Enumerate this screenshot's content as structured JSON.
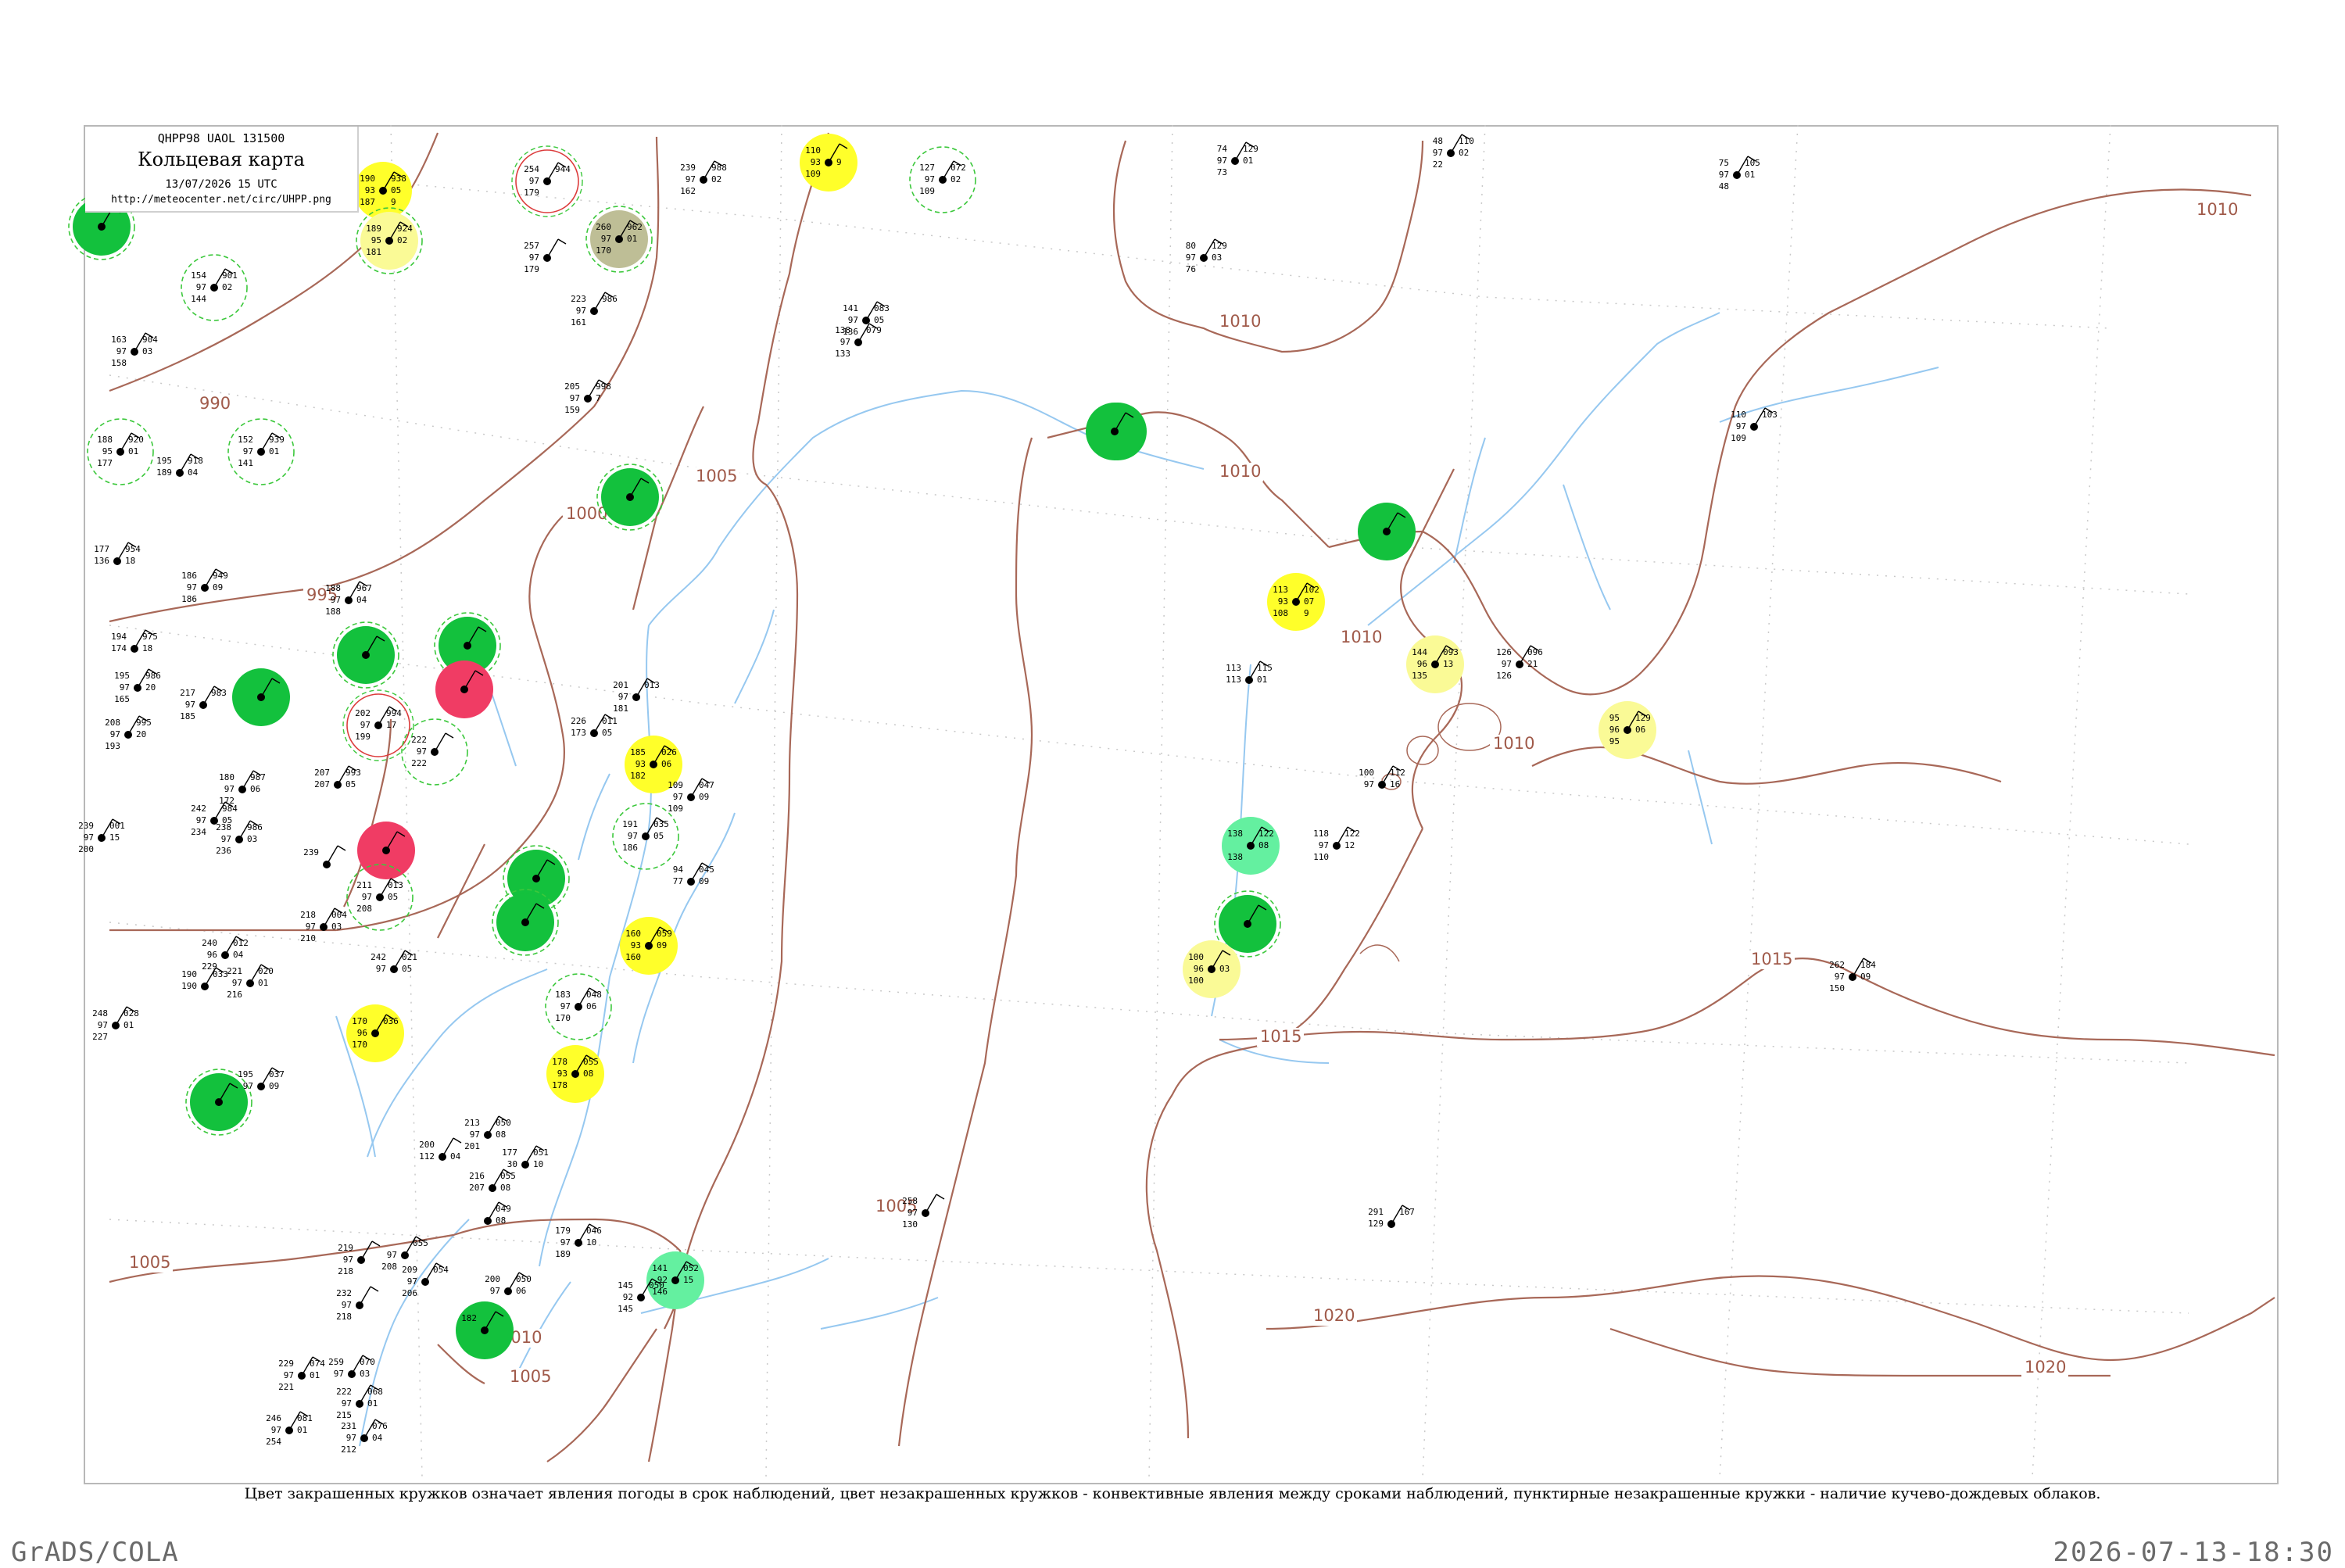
{
  "header": {
    "code_line": "QHPP98  UAOL  131500",
    "title": "Кольцевая карта",
    "date_line": "13/07/2026 15 UTC",
    "url": "http://meteocenter.net/circ/UHPP.png"
  },
  "caption": "Цвет закрашенных кружков означает явления погоды в срок наблюдений, цвет незакрашенных кружков - конвективные явления между сроками наблюдений, пунктирные незакрашенные кружки - наличие кучево-дождевых облаков.",
  "footer": {
    "left": "GrADS/COLA",
    "right": "2026-07-13-18:30"
  },
  "colors": {
    "frame": "#b8b8b8",
    "isobar": "#a86858",
    "coast": "#96c8f0",
    "circle_green": "#13c13d",
    "circle_yellow": "#ffff2a",
    "circle_lightyellow": "#fafa96",
    "circle_red": "#f03c64",
    "circle_mint": "#64f0a0",
    "circle_olive": "#bebe96",
    "dashed_ring": "#3cc83c",
    "dashed_ring_red": "#dc3c3c"
  },
  "isobar_labels": [
    "990",
    "995",
    "1000",
    "1005",
    "1005",
    "1010",
    "1010",
    "1010",
    "1010",
    "1010",
    "1005",
    "1005",
    "1015",
    "1015",
    "1020",
    "1020",
    "1010"
  ],
  "stations": [
    {
      "fill": "green",
      "ring": "green",
      "nums": [
        "",
        "",
        ""
      ]
    },
    {
      "fill": "yellow",
      "ring": "none",
      "nums": [
        "190",
        "93",
        "187",
        "938",
        "05",
        "9"
      ]
    },
    {
      "fill": "lightyellow",
      "ring": "green",
      "nums": [
        "189",
        "95",
        "181",
        "924",
        "02",
        ""
      ]
    },
    {
      "fill": "none",
      "ring": "green",
      "nums": [
        "154",
        "97",
        "144",
        "901",
        "02",
        ""
      ]
    },
    {
      "fill": "none",
      "ring": "none",
      "nums": [
        "163",
        "97",
        "158",
        "904",
        "03",
        ""
      ]
    },
    {
      "fill": "none",
      "ring": "green",
      "nums": [
        "188",
        "95",
        "177",
        "920",
        "01",
        ""
      ]
    },
    {
      "fill": "none",
      "ring": "green",
      "nums": [
        "152",
        "97",
        "141",
        "939",
        "01",
        ""
      ]
    },
    {
      "fill": "none",
      "ring": "none",
      "nums": [
        "195",
        "189",
        "",
        "918",
        "04",
        ""
      ]
    },
    {
      "fill": "none",
      "ring": "red",
      "nums": [
        "254",
        "97",
        "179",
        "944",
        "",
        ""
      ]
    },
    {
      "fill": "olive",
      "ring": "green",
      "nums": [
        "260",
        "97",
        "170",
        "962",
        "01",
        ""
      ]
    },
    {
      "fill": "none",
      "ring": "none",
      "nums": [
        "257",
        "97",
        "179",
        "",
        "",
        ""
      ]
    },
    {
      "fill": "none",
      "ring": "none",
      "nums": [
        "223",
        "97",
        "161",
        "986",
        "",
        ""
      ]
    },
    {
      "fill": "none",
      "ring": "none",
      "nums": [
        "205",
        "97",
        "159",
        "998",
        "7",
        ""
      ]
    },
    {
      "fill": "none",
      "ring": "none",
      "nums": [
        "239",
        "97",
        "162",
        "988",
        "02",
        ""
      ]
    },
    {
      "fill": "yellow",
      "ring": "none",
      "nums": [
        "110",
        "93",
        "109",
        "",
        "9",
        ""
      ]
    },
    {
      "fill": "none",
      "ring": "green",
      "nums": [
        "127",
        "97",
        "109",
        "072",
        "02",
        ""
      ]
    },
    {
      "fill": "green",
      "ring": "none",
      "nums": [
        "",
        "",
        ""
      ]
    },
    {
      "fill": "green",
      "ring": "green",
      "nums": [
        "",
        "",
        ""
      ]
    },
    {
      "fill": "none",
      "ring": "none",
      "nums": [
        "177",
        "136",
        "",
        "954",
        "18",
        ""
      ]
    },
    {
      "fill": "none",
      "ring": "none",
      "nums": [
        "186",
        "97",
        "186",
        "949",
        "09",
        ""
      ]
    },
    {
      "fill": "none",
      "ring": "none",
      "nums": [
        "188",
        "97",
        "188",
        "967",
        "04",
        ""
      ]
    },
    {
      "fill": "green",
      "ring": "green",
      "nums": [
        "",
        "",
        ""
      ]
    },
    {
      "fill": "green",
      "ring": "green",
      "nums": [
        "",
        "",
        ""
      ]
    },
    {
      "fill": "red",
      "ring": "none",
      "nums": [
        "",
        "",
        ""
      ]
    },
    {
      "fill": "green",
      "ring": "none",
      "nums": [
        "",
        "",
        ""
      ]
    },
    {
      "fill": "none",
      "ring": "red",
      "nums": [
        "202",
        "97",
        "199",
        "994",
        "17",
        ""
      ]
    },
    {
      "fill": "none",
      "ring": "none",
      "nums": [
        "194",
        "174",
        "",
        "975",
        "18",
        ""
      ]
    },
    {
      "fill": "none",
      "ring": "none",
      "nums": [
        "195",
        "97",
        "165",
        "986",
        "20",
        ""
      ]
    },
    {
      "fill": "none",
      "ring": "none",
      "nums": [
        "217",
        "97",
        "185",
        "983",
        "",
        ""
      ]
    },
    {
      "fill": "none",
      "ring": "none",
      "nums": [
        "208",
        "97",
        "193",
        "995",
        "20",
        ""
      ]
    },
    {
      "fill": "none",
      "ring": "green",
      "nums": [
        "222",
        "97",
        "222",
        "",
        "",
        ""
      ]
    },
    {
      "fill": "none",
      "ring": "none",
      "nums": [
        "201",
        "97",
        "181",
        "013",
        "",
        ""
      ]
    },
    {
      "fill": "none",
      "ring": "none",
      "nums": [
        "226",
        "173",
        "",
        "011",
        "05",
        ""
      ]
    },
    {
      "fill": "yellow",
      "ring": "none",
      "nums": [
        "185",
        "93",
        "182",
        "026",
        "06",
        ""
      ]
    },
    {
      "fill": "none",
      "ring": "none",
      "nums": [
        "109",
        "97",
        "109",
        "047",
        "09",
        ""
      ]
    },
    {
      "fill": "none",
      "ring": "none",
      "nums": [
        "180",
        "97",
        "172",
        "987",
        "06",
        ""
      ]
    },
    {
      "fill": "none",
      "ring": "none",
      "nums": [
        "207",
        "207",
        "",
        "993",
        "05",
        ""
      ]
    },
    {
      "fill": "none",
      "ring": "none",
      "nums": [
        "242",
        "97",
        "234",
        "984",
        "05",
        ""
      ]
    },
    {
      "fill": "none",
      "ring": "none",
      "nums": [
        "238",
        "97",
        "236",
        "986",
        "03",
        ""
      ]
    },
    {
      "fill": "none",
      "ring": "none",
      "nums": [
        "239",
        "97",
        "200",
        "001",
        "15",
        ""
      ]
    },
    {
      "fill": "red",
      "ring": "none",
      "nums": [
        "",
        "",
        ""
      ]
    },
    {
      "fill": "none",
      "ring": "none",
      "nums": [
        "239",
        "",
        "",
        "",
        "",
        ""
      ]
    },
    {
      "fill": "none",
      "ring": "green",
      "nums": [
        "211",
        "97",
        "208",
        "013",
        "05",
        ""
      ]
    },
    {
      "fill": "green",
      "ring": "green",
      "nums": [
        "",
        "",
        ""
      ]
    },
    {
      "fill": "green",
      "ring": "green",
      "nums": [
        "",
        "",
        ""
      ]
    },
    {
      "fill": "none",
      "ring": "green",
      "nums": [
        "191",
        "97",
        "186",
        "035",
        "05",
        ""
      ]
    },
    {
      "fill": "none",
      "ring": "none",
      "nums": [
        "94",
        "77",
        "",
        "045",
        "09",
        ""
      ]
    },
    {
      "fill": "yellow",
      "ring": "none",
      "nums": [
        "160",
        "93",
        "160",
        "059",
        "09",
        ""
      ]
    },
    {
      "fill": "none",
      "ring": "none",
      "nums": [
        "218",
        "97",
        "210",
        "004",
        "03",
        ""
      ]
    },
    {
      "fill": "none",
      "ring": "none",
      "nums": [
        "240",
        "96",
        "229",
        "012",
        "04",
        ""
      ]
    },
    {
      "fill": "none",
      "ring": "none",
      "nums": [
        "190",
        "190",
        "",
        "033",
        "",
        ""
      ]
    },
    {
      "fill": "none",
      "ring": "none",
      "nums": [
        "242",
        "97",
        "",
        "021",
        "05",
        ""
      ]
    },
    {
      "fill": "none",
      "ring": "none",
      "nums": [
        "221",
        "97",
        "216",
        "020",
        "01",
        ""
      ]
    },
    {
      "fill": "none",
      "ring": "none",
      "nums": [
        "248",
        "97",
        "227",
        "028",
        "01",
        ""
      ]
    },
    {
      "fill": "yellow",
      "ring": "none",
      "nums": [
        "170",
        "96",
        "170",
        "036",
        "",
        ""
      ]
    },
    {
      "fill": "none",
      "ring": "green",
      "nums": [
        "183",
        "97",
        "170",
        "048",
        "06",
        ""
      ]
    },
    {
      "fill": "yellow",
      "ring": "none",
      "nums": [
        "178",
        "93",
        "178",
        "055",
        "08",
        ""
      ]
    },
    {
      "fill": "green",
      "ring": "green",
      "nums": [
        "",
        "",
        ""
      ]
    },
    {
      "fill": "none",
      "ring": "none",
      "nums": [
        "195",
        "97",
        "",
        "037",
        "09",
        ""
      ]
    },
    {
      "fill": "none",
      "ring": "none",
      "nums": [
        "200",
        "112",
        "",
        "",
        "04",
        ""
      ]
    },
    {
      "fill": "none",
      "ring": "none",
      "nums": [
        "213",
        "97",
        "201",
        "050",
        "08",
        ""
      ]
    },
    {
      "fill": "none",
      "ring": "none",
      "nums": [
        "177",
        "30",
        "",
        "051",
        "10",
        ""
      ]
    },
    {
      "fill": "none",
      "ring": "none",
      "nums": [
        "216",
        "207",
        "",
        "055",
        "08",
        ""
      ]
    },
    {
      "fill": "none",
      "ring": "none",
      "nums": [
        "",
        "",
        "",
        "049",
        "08",
        ""
      ]
    },
    {
      "fill": "none",
      "ring": "none",
      "nums": [
        "219",
        "97",
        "218",
        "",
        "",
        ""
      ]
    },
    {
      "fill": "none",
      "ring": "none",
      "nums": [
        "",
        "97",
        "208",
        "055",
        "",
        ""
      ]
    },
    {
      "fill": "none",
      "ring": "none",
      "nums": [
        "209",
        "97",
        "206",
        "054",
        "",
        ""
      ]
    },
    {
      "fill": "none",
      "ring": "none",
      "nums": [
        "200",
        "97",
        "",
        "050",
        "06",
        ""
      ]
    },
    {
      "fill": "none",
      "ring": "none",
      "nums": [
        "179",
        "97",
        "189",
        "046",
        "10",
        ""
      ]
    },
    {
      "fill": "mint",
      "ring": "none",
      "nums": [
        "141",
        "92",
        "146",
        "052",
        "15",
        ""
      ]
    },
    {
      "fill": "none",
      "ring": "none",
      "nums": [
        "145",
        "92",
        "145",
        "050",
        "",
        ""
      ]
    },
    {
      "fill": "green",
      "ring": "none",
      "nums": [
        "182",
        "",
        "",
        "",
        "",
        ""
      ]
    },
    {
      "fill": "none",
      "ring": "none",
      "nums": [
        "232",
        "97",
        "218",
        "",
        "",
        ""
      ]
    },
    {
      "fill": "none",
      "ring": "none",
      "nums": [
        "229",
        "97",
        "221",
        "074",
        "01",
        ""
      ]
    },
    {
      "fill": "none",
      "ring": "none",
      "nums": [
        "259",
        "97",
        "",
        "070",
        "03",
        ""
      ]
    },
    {
      "fill": "none",
      "ring": "none",
      "nums": [
        "222",
        "97",
        "215",
        "068",
        "01",
        ""
      ]
    },
    {
      "fill": "none",
      "ring": "none",
      "nums": [
        "246",
        "97",
        "254",
        "081",
        "01",
        ""
      ]
    },
    {
      "fill": "none",
      "ring": "none",
      "nums": [
        "231",
        "97",
        "212",
        "076",
        "04",
        ""
      ]
    },
    {
      "fill": "none",
      "ring": "none",
      "nums": [
        "74",
        "97",
        "73",
        "129",
        "01",
        ""
      ]
    },
    {
      "fill": "none",
      "ring": "none",
      "nums": [
        "48",
        "97",
        "22",
        "110",
        "02",
        ""
      ]
    },
    {
      "fill": "none",
      "ring": "none",
      "nums": [
        "75",
        "97",
        "48",
        "105",
        "01",
        ""
      ]
    },
    {
      "fill": "none",
      "ring": "none",
      "nums": [
        "80",
        "97",
        "76",
        "129",
        "03",
        ""
      ]
    },
    {
      "fill": "none",
      "ring": "none",
      "nums": [
        "141",
        "97",
        "136",
        "083",
        "05",
        ""
      ]
    },
    {
      "fill": "none",
      "ring": "none",
      "nums": [
        "138",
        "97",
        "133",
        "079",
        "",
        ""
      ]
    },
    {
      "fill": "none",
      "ring": "none",
      "nums": [
        "110",
        "97",
        "109",
        "103",
        "",
        ""
      ]
    },
    {
      "fill": "green",
      "ring": "none",
      "nums": [
        "",
        "",
        ""
      ]
    },
    {
      "fill": "green",
      "ring": "none",
      "nums": [
        "",
        "",
        ""
      ]
    },
    {
      "fill": "yellow",
      "ring": "none",
      "nums": [
        "113",
        "93",
        "108",
        "102",
        "07",
        "9"
      ]
    },
    {
      "fill": "lightyellow",
      "ring": "none",
      "nums": [
        "144",
        "96",
        "135",
        "093",
        "13",
        ""
      ]
    },
    {
      "fill": "none",
      "ring": "none",
      "nums": [
        "126",
        "97",
        "126",
        "096",
        "21",
        ""
      ]
    },
    {
      "fill": "lightyellow",
      "ring": "none",
      "nums": [
        "95",
        "96",
        "95",
        "129",
        "06",
        ""
      ]
    },
    {
      "fill": "none",
      "ring": "none",
      "nums": [
        "113",
        "113",
        "",
        "115",
        "01",
        ""
      ]
    },
    {
      "fill": "none",
      "ring": "none",
      "nums": [
        "100",
        "97",
        "",
        "112",
        "16",
        ""
      ]
    },
    {
      "fill": "mint",
      "ring": "none",
      "nums": [
        "138",
        "",
        "138",
        "122",
        "08",
        ""
      ]
    },
    {
      "fill": "none",
      "ring": "none",
      "nums": [
        "118",
        "97",
        "110",
        "122",
        "12",
        ""
      ]
    },
    {
      "fill": "green",
      "ring": "green",
      "nums": [
        "",
        "",
        ""
      ]
    },
    {
      "fill": "lightyellow",
      "ring": "none",
      "nums": [
        "100",
        "96",
        "100",
        "",
        "03",
        ""
      ]
    },
    {
      "fill": "none",
      "ring": "none",
      "nums": [
        "262",
        "97",
        "150",
        "184",
        "09",
        ""
      ]
    },
    {
      "fill": "none",
      "ring": "none",
      "nums": [
        "258",
        "97",
        "130",
        "",
        "",
        ""
      ]
    },
    {
      "fill": "none",
      "ring": "none",
      "nums": [
        "291",
        "129",
        "",
        "167",
        "",
        ""
      ]
    }
  ]
}
